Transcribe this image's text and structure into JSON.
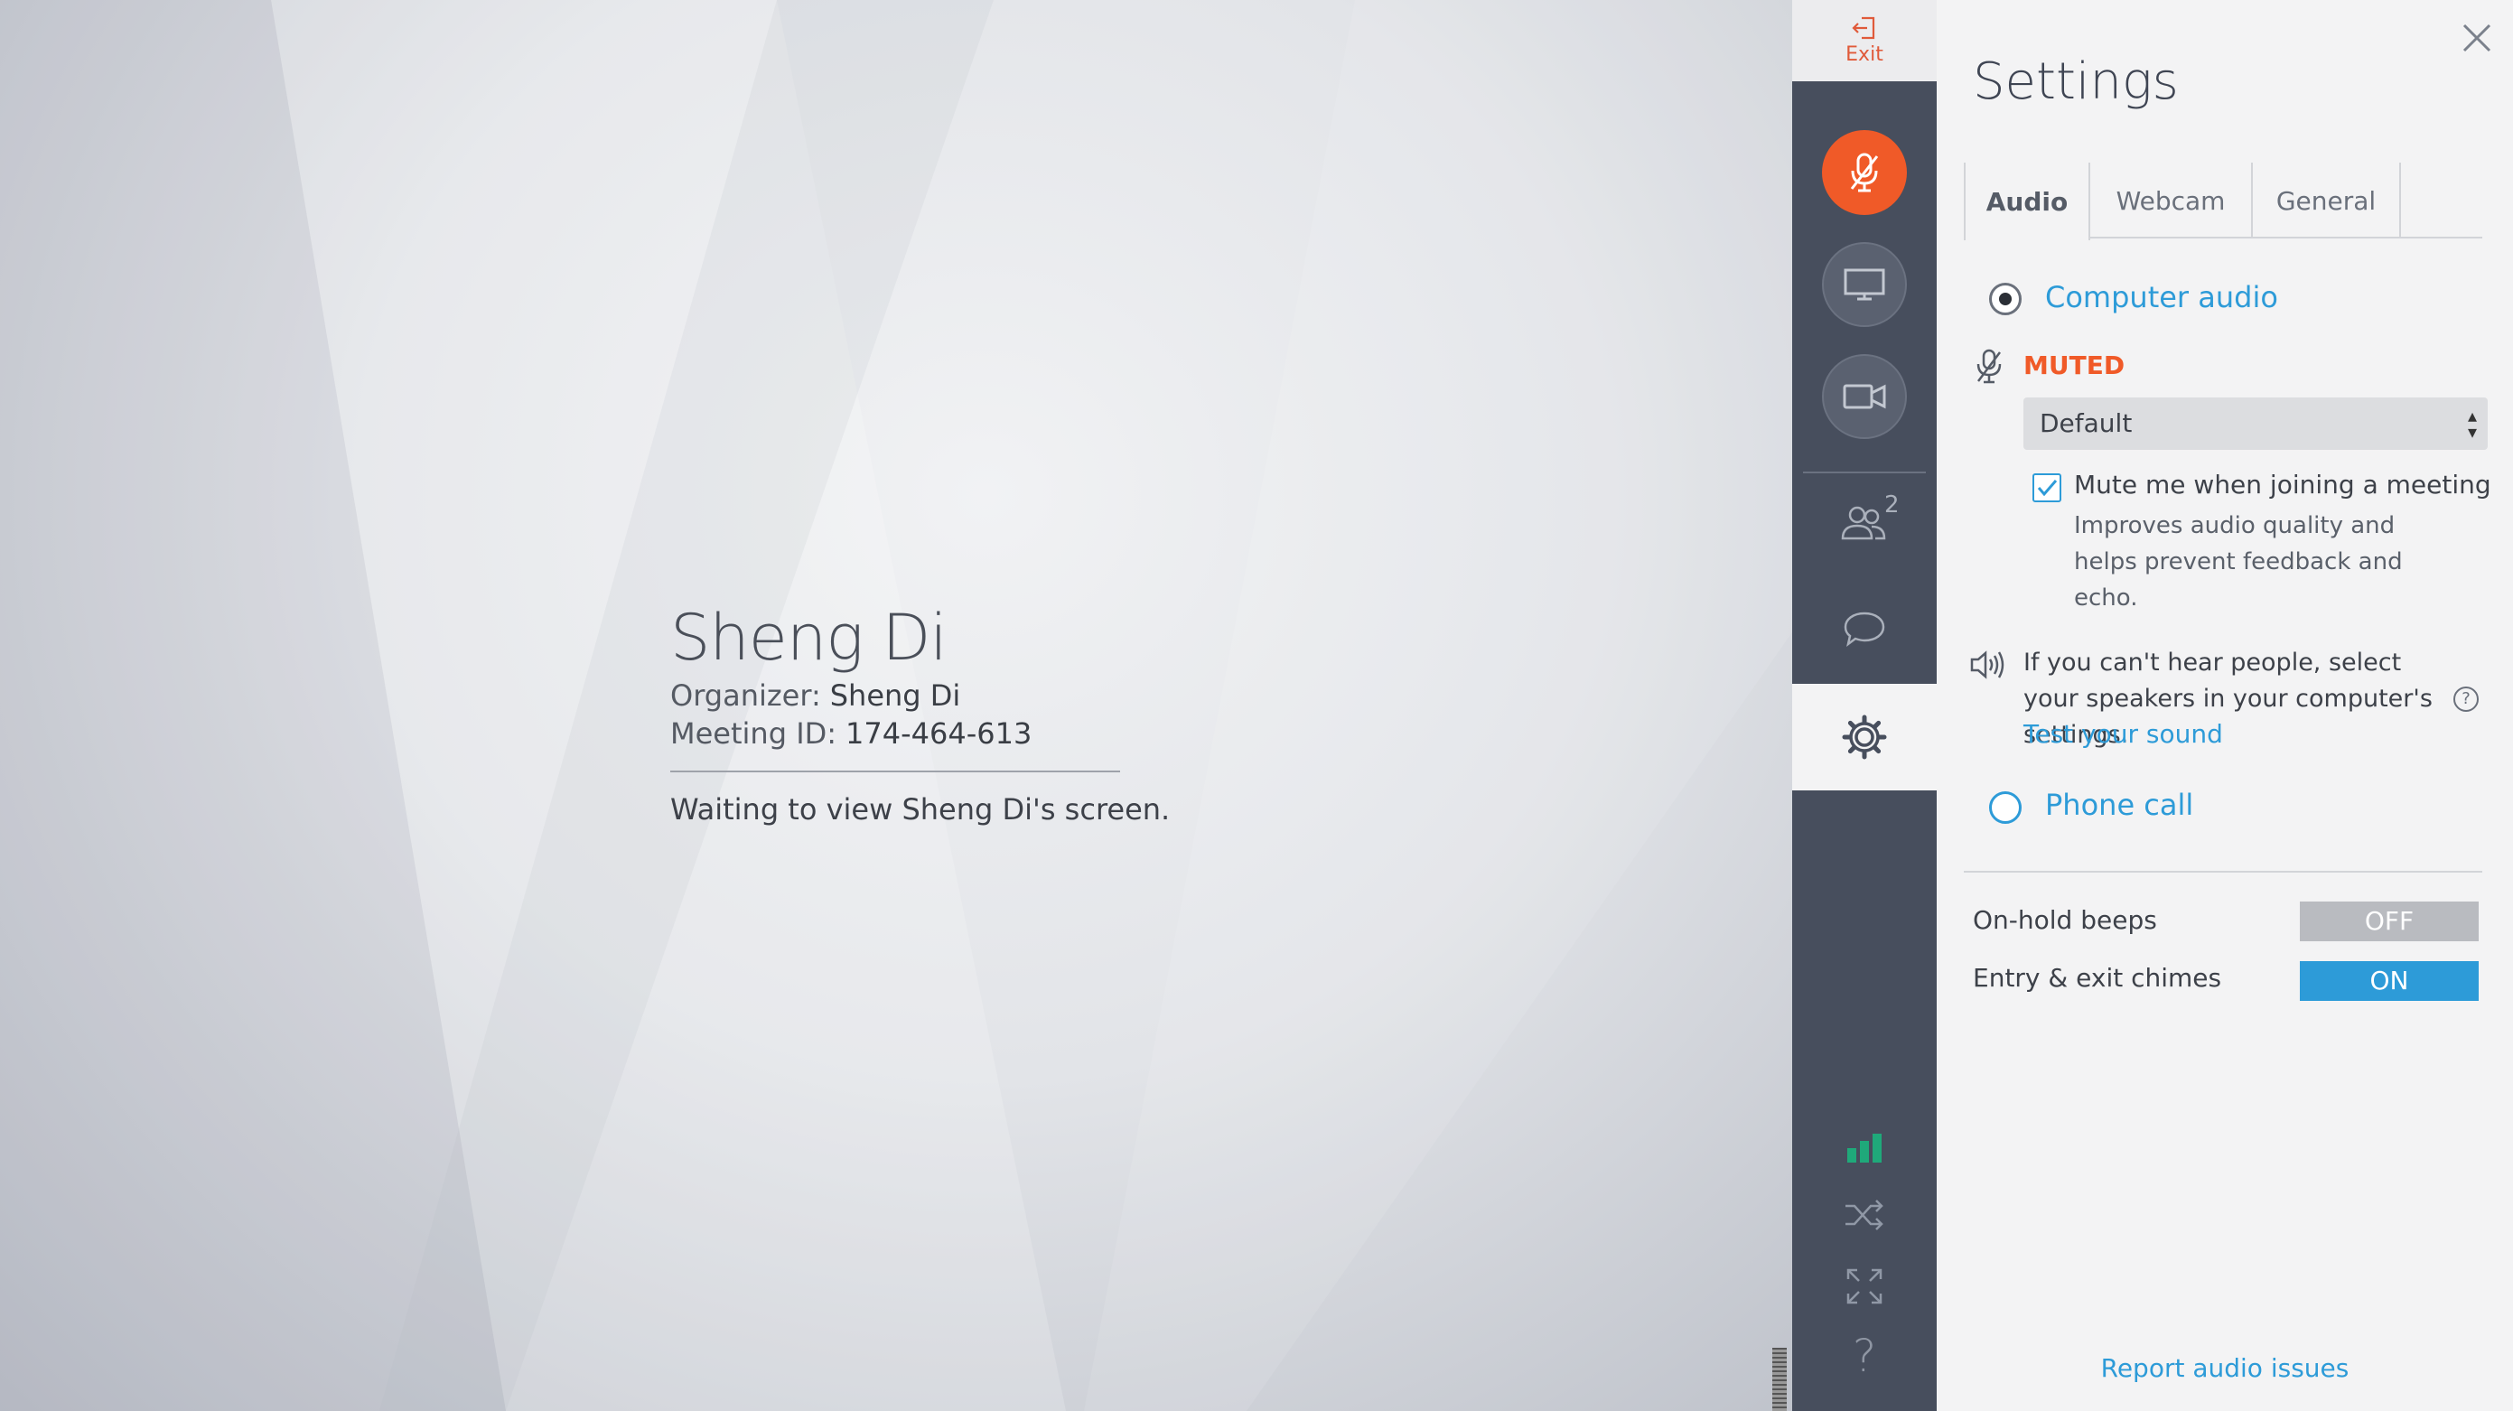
{
  "meeting": {
    "host_name": "Sheng Di",
    "organizer_label": "Organizer:",
    "organizer_value": "Sheng Di",
    "meeting_id_label": "Meeting ID:",
    "meeting_id_value": "174-464-613",
    "status": "Waiting to view Sheng Di's screen."
  },
  "sidebar": {
    "exit_label": "Exit",
    "attendee_count": "2",
    "mic_color": "#f05a28",
    "signal_color": "#1fa97a",
    "icons": [
      "exit-icon",
      "microphone-muted-icon",
      "screen-share-icon",
      "webcam-icon",
      "attendees-icon",
      "chat-icon",
      "gear-icon",
      "signal-bars-icon",
      "shuffle-icon",
      "expand-icon",
      "question-icon"
    ]
  },
  "settings": {
    "title": "Settings",
    "tabs": [
      {
        "label": "Audio",
        "active": true
      },
      {
        "label": "Webcam",
        "active": false
      },
      {
        "label": "General",
        "active": false
      }
    ],
    "computer_audio_label": "Computer audio",
    "computer_audio_selected": true,
    "muted_label": "MUTED",
    "device_selected": "Default",
    "mute_on_join_label": "Mute me when joining a meeting",
    "mute_on_join_checked": true,
    "mute_on_join_hint": "Improves audio quality and helps prevent feedback and echo.",
    "speaker_hint": "If you can't hear people, select your speakers in your computer's settings.",
    "help_glyph": "?",
    "test_sound_link": "Test your sound",
    "phone_call_label": "Phone call",
    "phone_call_selected": false,
    "on_hold_beeps_label": "On-hold beeps",
    "on_hold_beeps_state": "OFF",
    "entry_exit_chimes_label": "Entry & exit chimes",
    "entry_exit_chimes_state": "ON",
    "report_link": "Report audio issues",
    "accent_color": "#2d9bd8",
    "alert_color": "#f05a28"
  }
}
